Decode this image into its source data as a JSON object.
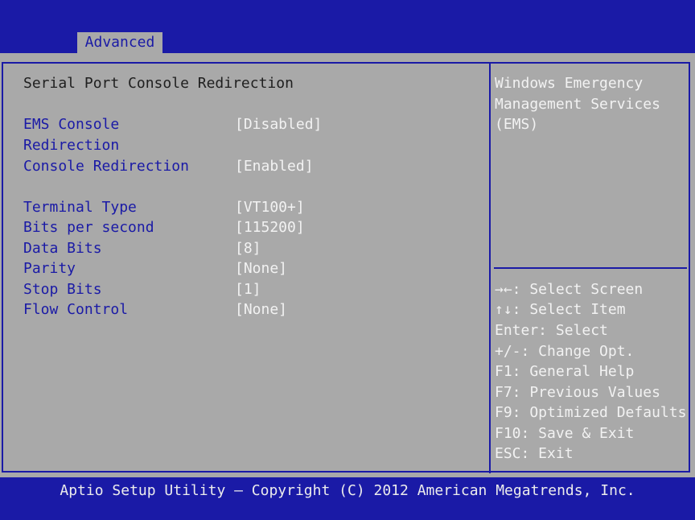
{
  "tabs": {
    "active": "Advanced"
  },
  "section_title": "Serial Port Console Redirection",
  "settings": [
    {
      "label_line1": "EMS Console",
      "label_line2": "Redirection",
      "value": "[Disabled]"
    },
    {
      "label": "Console Redirection",
      "value": "[Enabled]"
    },
    {
      "label": "Terminal Type",
      "value": "[VT100+]"
    },
    {
      "label": "Bits per second",
      "value": "[115200]"
    },
    {
      "label": "Data Bits",
      "value": "[8]"
    },
    {
      "label": "Parity",
      "value": "[None]"
    },
    {
      "label": "Stop Bits",
      "value": "[1]"
    },
    {
      "label": "Flow Control",
      "value": "[None]"
    }
  ],
  "help_text": [
    "Windows Emergency",
    "Management Services",
    "(EMS)"
  ],
  "key_help": [
    "→←: Select Screen",
    "↑↓: Select Item",
    "Enter: Select",
    "+/-: Change Opt.",
    "F1: General Help",
    "F7: Previous Values",
    "F9: Optimized Defaults",
    "F10: Save & Exit",
    "ESC: Exit"
  ],
  "footer": "Aptio Setup Utility – Copyright (C) 2012 American Megatrends, Inc.",
  "colors": {
    "bios_blue": "#1a1aa6",
    "panel_gray": "#a9a9a9",
    "text_white": "#f2f2f2"
  }
}
